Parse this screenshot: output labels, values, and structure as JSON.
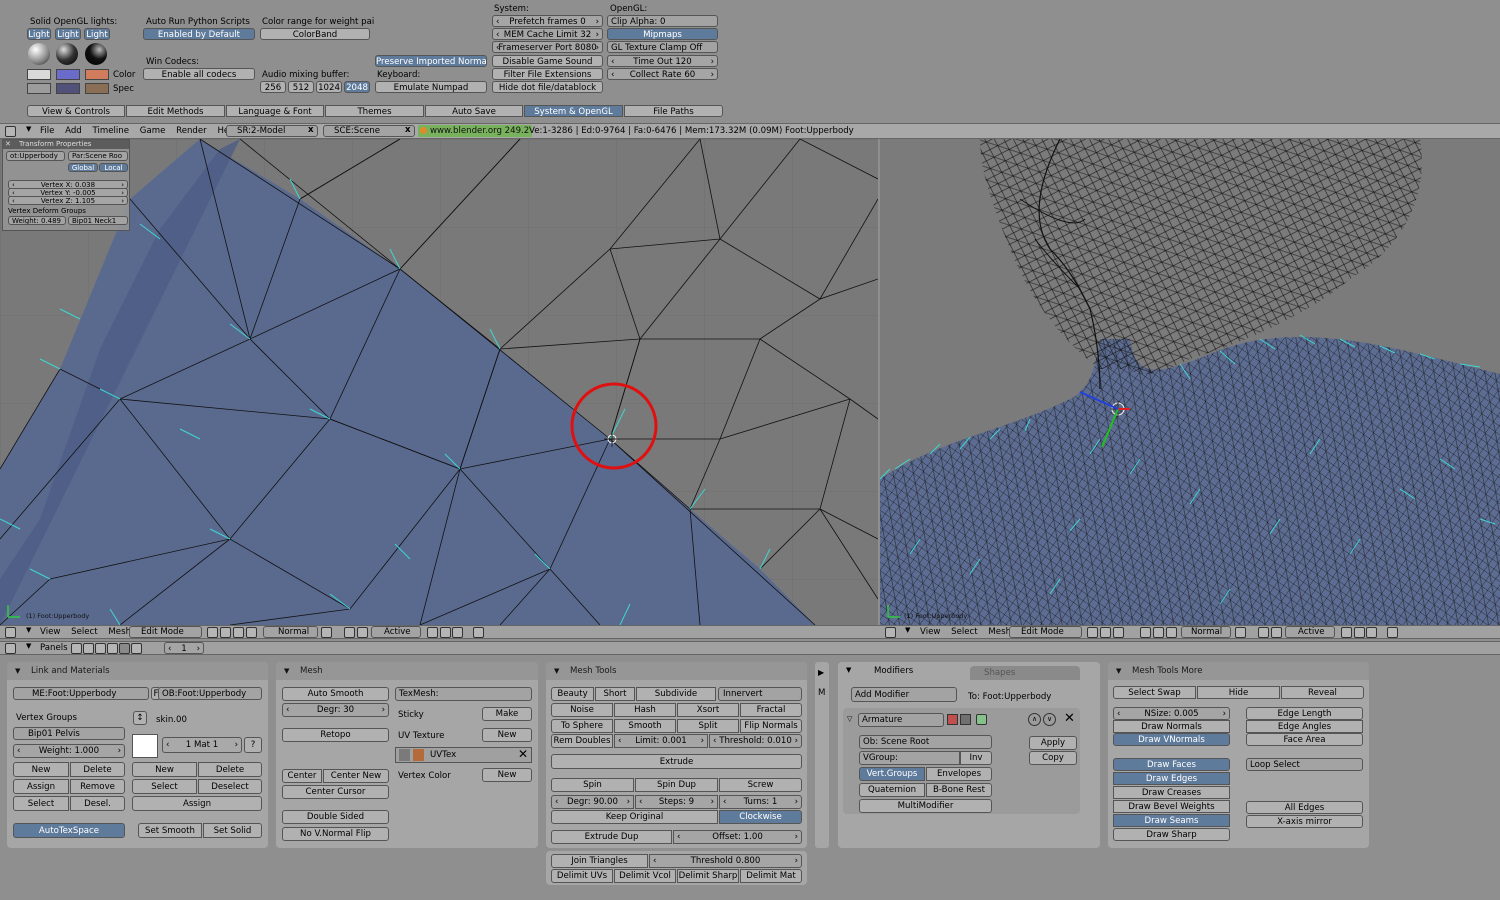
{
  "prefs": {
    "solid_lights_label": "Solid OpenGL lights:",
    "light_buttons": [
      "Light",
      "Light",
      "Light"
    ],
    "color_label": "Color",
    "spec_label": "Spec",
    "auto_run_label": "Auto Run Python Scripts",
    "auto_run_btn": "Enabled by Default",
    "win_codecs_label": "Win Codecs:",
    "win_codecs_btn": "Enable all codecs",
    "color_range_label": "Color range for weight pai",
    "color_range_btn": "ColorBand",
    "audio_label": "Audio mixing buffer:",
    "audio_buttons": [
      "256",
      "512",
      "1024",
      "2048"
    ],
    "preserve_btn": "Preserve Imported Normal",
    "keyboard_label": "Keyboard:",
    "emulate_btn": "Emulate Numpad",
    "system_label": "System:",
    "prefetch": "Prefetch frames 0",
    "memcache": "MEM Cache Limit 32",
    "frameserver": "Frameserver Port 8080",
    "disable_sound": "Disable Game Sound",
    "filter_ext": "Filter File Extensions",
    "hide_dot": "Hide dot file/datablock",
    "opengl_label": "OpenGL:",
    "clip_alpha": "Clip Alpha: 0",
    "mipmaps": "Mipmaps",
    "gl_clamp": "GL Texture Clamp Off",
    "timeout": "Time Out 120",
    "collect_rate": "Collect Rate 60",
    "tabs": [
      "View & Controls",
      "Edit Methods",
      "Language & Font",
      "Themes",
      "Auto Save",
      "System & OpenGL",
      "File Paths"
    ]
  },
  "info_header": {
    "menus": [
      "File",
      "Add",
      "Timeline",
      "Game",
      "Render",
      "Help"
    ],
    "screen": "SR:2-Model",
    "scene": "SCE:Scene",
    "version": "www.blender.org 249.2",
    "stats": "Ve:1-3286 | Ed:0-9764 | Fa:0-6476 | Mem:173.32M (0.09M) Foot:Upperbody"
  },
  "transform": {
    "title": "Transform Properties",
    "ob": "ot:Upperbody",
    "par": "Par:Scene Roo",
    "global": "Global",
    "local": "Local",
    "vx": "Vertex X: 0.038",
    "vy": "Vertex Y: -0.005",
    "vz": "Vertex Z: 1.105",
    "deform": "Vertex Deform Groups",
    "weight": "Weight: 0.489",
    "bone": "Bip01 Neck1"
  },
  "viewports": {
    "left_label": "(1) Foot:Upperbody",
    "right_label": "(1) Foot:Upperbody",
    "menus": [
      "View",
      "Select",
      "Mesh"
    ],
    "mode": "Edit Mode",
    "orient": "Normal",
    "pivot": "Active"
  },
  "buttons_header": {
    "panels": "Panels",
    "frame": "1"
  },
  "link_materials": {
    "title": "Link and Materials",
    "me": "ME:Foot:Upperbody",
    "f": "F",
    "ob": "OB:Foot:Upperbody",
    "vgroups_label": "Vertex Groups",
    "skin": "skin.00",
    "group": "Bip01 Pelvis",
    "weight": "Weight: 1.000",
    "mat": "1 Mat 1",
    "q": "?",
    "new1": "New",
    "delete1": "Delete",
    "new2": "New",
    "delete2": "Delete",
    "assign1": "Assign",
    "remove": "Remove",
    "select2": "Select",
    "deselect2": "Deselect",
    "select1": "Select",
    "desel1": "Desel.",
    "assign2": "Assign",
    "autotex": "AutoTexSpace",
    "set_smooth": "Set Smooth",
    "set_solid": "Set Solid"
  },
  "mesh": {
    "title": "Mesh",
    "auto_smooth": "Auto Smooth",
    "degr": "Degr: 30",
    "retopo": "Retopo",
    "center": "Center",
    "center_new": "Center New",
    "center_cursor": "Center Cursor",
    "double_sided": "Double Sided",
    "no_vnormal": "No V.Normal Flip",
    "texmesh": "TexMesh:",
    "sticky": "Sticky",
    "make": "Make",
    "uv_texture": "UV Texture",
    "new_uv": "New",
    "uvtex": "UVTex",
    "vertex_color": "Vertex Color",
    "new_vc": "New"
  },
  "mesh_tools": {
    "title": "Mesh Tools",
    "beauty": "Beauty",
    "short": "Short",
    "subdivide": "Subdivide",
    "innervert": "Innervert",
    "noise": "Noise",
    "hash": "Hash",
    "xsort": "Xsort",
    "fractal": "Fractal",
    "to_sphere": "To Sphere",
    "smooth": "Smooth",
    "split": "Split",
    "flip_normals": "Flip Normals",
    "rem_doubles": "Rem Doubles",
    "limit": "Limit: 0.001",
    "threshold": "Threshold: 0.010",
    "extrude": "Extrude",
    "spin": "Spin",
    "spin_dup": "Spin Dup",
    "screw": "Screw",
    "degr": "Degr: 90.00",
    "steps": "Steps: 9",
    "turns": "Turns: 1",
    "keep_original": "Keep Original",
    "clockwise": "Clockwise",
    "extrude_dup": "Extrude Dup",
    "offset": "Offset: 1.00",
    "join_triangles": "Join Triangles",
    "threshold2": "Threshold 0.800",
    "delimit_uvs": "Delimit UVs",
    "delimit_vcol": "Delimit Vcol",
    "delimit_sharp": "Delimit Sharp",
    "delimit_mat": "Delimit Mat"
  },
  "side_tab": "M",
  "modifiers": {
    "tab_modifiers": "Modifiers",
    "tab_shapes": "Shapes",
    "add_modifier": "Add Modifier",
    "to": "To: Foot:Upperbody",
    "armature": "Armature",
    "ob": "Ob: Scene Root",
    "vgroup": "VGroup:",
    "inv": "Inv",
    "vert_groups": "Vert.Groups",
    "envelopes": "Envelopes",
    "quaternion": "Quaternion",
    "bbone": "B-Bone Rest",
    "multimodifier": "MultiModifier",
    "apply": "Apply",
    "copy": "Copy"
  },
  "mesh_tools_more": {
    "title": "Mesh Tools More",
    "select_swap": "Select Swap",
    "hide": "Hide",
    "reveal": "Reveal",
    "nsize": "NSize: 0.005",
    "draw_normals": "Draw Normals",
    "draw_vnormals": "Draw VNormals",
    "edge_length": "Edge Length",
    "edge_angles": "Edge Angles",
    "face_area": "Face Area",
    "draw_faces": "Draw Faces",
    "draw_edges": "Draw Edges",
    "draw_creases": "Draw Creases",
    "draw_bevel": "Draw Bevel Weights",
    "draw_seams": "Draw Seams",
    "draw_sharp": "Draw Sharp",
    "loop_select": "Loop Select",
    "all_edges": "All Edges",
    "xaxis_mirror": "X-axis mirror"
  }
}
